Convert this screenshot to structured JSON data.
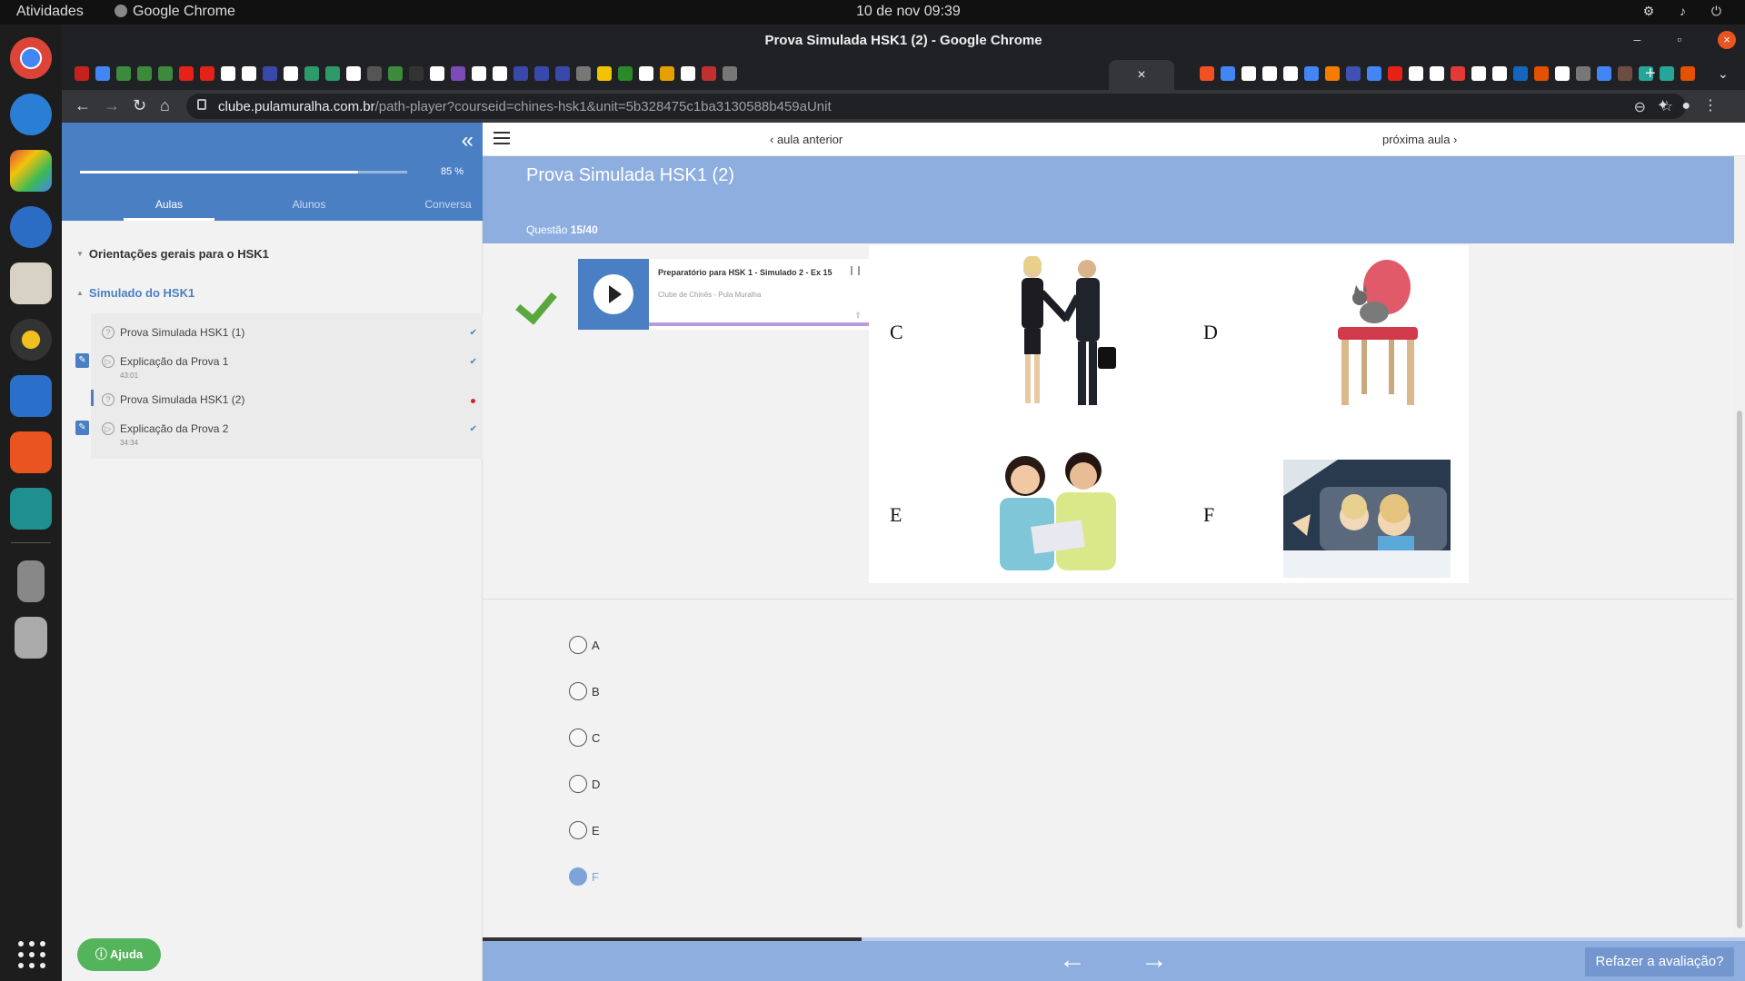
{
  "os": {
    "activities": "Atividades",
    "app_name": "Google Chrome",
    "clock": "10 de nov  09:39"
  },
  "browser": {
    "window_title": "Prova Simulada HSK1 (2) - Google Chrome",
    "url_host": "clube.pulamuralha.com.br",
    "url_path": "/path-player?courseid=chines-hsk1&unit=5b328475c1ba3130588b459aUnit"
  },
  "sidebar": {
    "progress_percent": 85,
    "progress_label": "85 %",
    "tabs": [
      "Aulas",
      "Alunos",
      "Conversa"
    ],
    "sections": [
      {
        "title": "Orientações gerais para o HSK1"
      },
      {
        "title": "Simulado do HSK1"
      }
    ],
    "lessons": [
      {
        "name": "Prova Simulada HSK1 (1)",
        "duration": ""
      },
      {
        "name": "Explicação da Prova 1",
        "duration": "43:01"
      },
      {
        "name": "Prova Simulada HSK1 (2)",
        "duration": ""
      },
      {
        "name": "Explicação da Prova 2",
        "duration": "34:34"
      }
    ],
    "help_label": "Ajuda"
  },
  "nav": {
    "prev": "aula anterior",
    "next": "próxima aula"
  },
  "page": {
    "title": "Prova Simulada HSK1 (2)",
    "question_prefix": "Questão",
    "question_number": "15/40"
  },
  "player": {
    "title": "Preparatório para HSK 1 - Simulado 2 - Ex 15",
    "subtitle": "Clube de Chinês - Pula Muralha"
  },
  "images": {
    "letters": [
      "C",
      "D",
      "E",
      "F"
    ]
  },
  "answers": {
    "options": [
      "A",
      "B",
      "C",
      "D",
      "E",
      "F"
    ],
    "selected": "F"
  },
  "footer": {
    "progress_fraction": 0.3,
    "redo_label": "Refazer a avaliação?"
  },
  "colors": {
    "primary": "#4b7fc4",
    "banner": "#8eaee0",
    "success": "#5aa83c"
  }
}
